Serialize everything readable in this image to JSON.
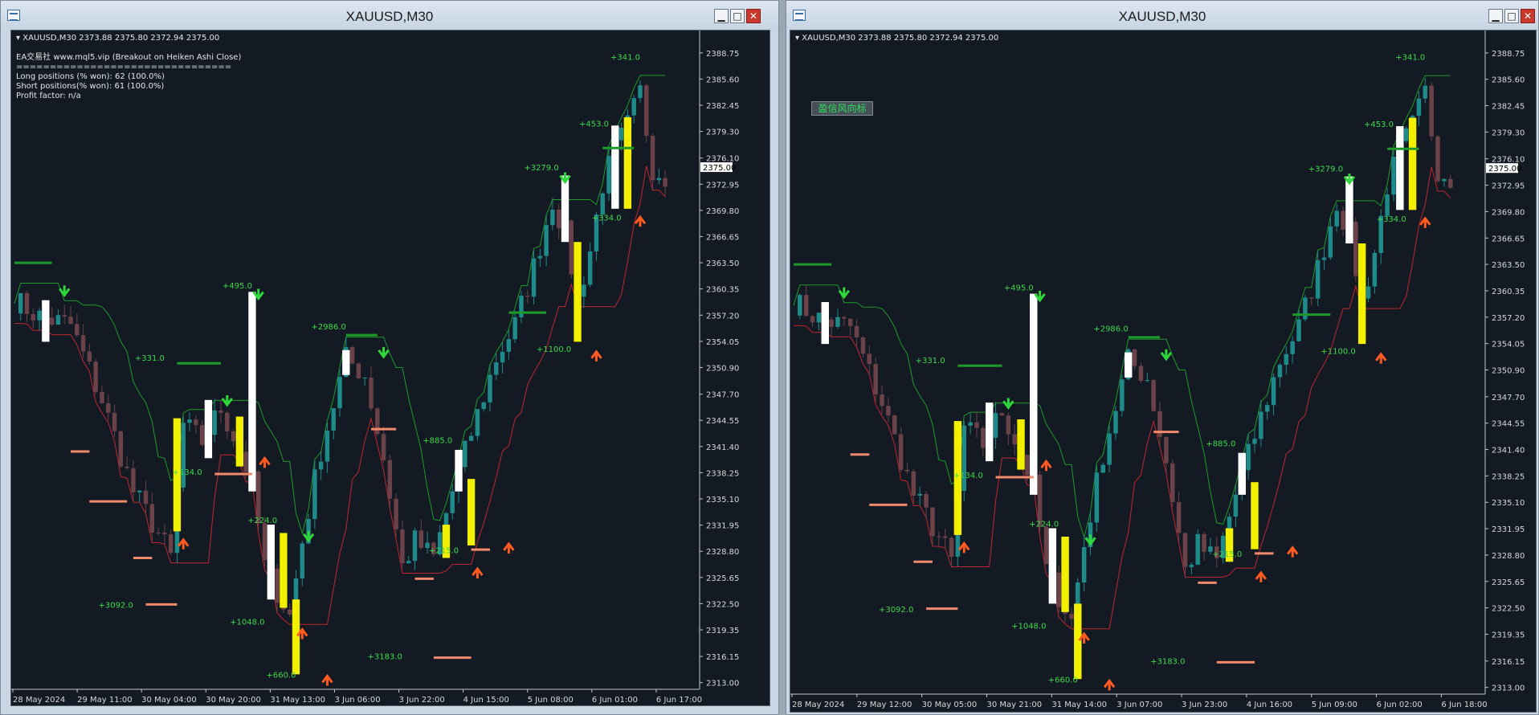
{
  "windows": [
    {
      "id": "left",
      "title": "XAUUSD,M30",
      "ohlc": "XAUUSD,M30  2373.88 2375.80 2372.94 2375.00",
      "info_lines": [
        "EA交易社 www.mql5.vip (Breakout on Heiken Ashi Close)",
        "================================",
        "Long positions (% won): 62 (100.0%)",
        "Short positions(% won): 61 (100.0%)",
        "Profit factor: n/a"
      ],
      "price_tag": "2375.00",
      "x_labels": [
        "28 May 2024",
        "29 May 11:00",
        "30 May 04:00",
        "30 May 20:00",
        "31 May 13:00",
        "3 Jun 06:00",
        "3 Jun 22:00",
        "4 Jun 15:00",
        "5 Jun 08:00",
        "6 Jun 01:00",
        "6 Jun 17:00"
      ]
    },
    {
      "id": "right",
      "title": "XAUUSD,M30",
      "ohlc": "XAUUSD,M30  2373.88 2375.80 2372.94 2375.00",
      "label_button": "盈信风向标",
      "price_tag": "2375.00",
      "x_labels": [
        "28 May 2024",
        "29 May 12:00",
        "30 May 05:00",
        "30 May 21:00",
        "31 May 14:00",
        "3 Jun 07:00",
        "3 Jun 23:00",
        "4 Jun 16:00",
        "5 Jun 09:00",
        "6 Jun 02:00",
        "6 Jun 18:00"
      ]
    }
  ],
  "window_controls": {
    "minimize": "▁",
    "maximize": "□",
    "close": "✕"
  },
  "y_labels": [
    "2388.75",
    "2385.60",
    "2382.45",
    "2379.30",
    "2376.10",
    "2372.95",
    "2369.80",
    "2366.65",
    "2363.50",
    "2360.35",
    "2357.20",
    "2354.05",
    "2350.90",
    "2347.70",
    "2344.55",
    "2341.40",
    "2338.25",
    "2335.10",
    "2331.95",
    "2328.80",
    "2325.65",
    "2322.50",
    "2319.35",
    "2316.15",
    "2313.00"
  ],
  "trade_labels": [
    {
      "text": "+341.0",
      "bar": 100,
      "price": 2387.9
    },
    {
      "text": "+453.0",
      "bar": 95,
      "price": 2379.9
    },
    {
      "text": "+3279.0",
      "bar": 87,
      "price": 2374.6
    },
    {
      "text": "+334.0",
      "bar": 97,
      "price": 2368.6
    },
    {
      "text": "+495.0",
      "bar": 38,
      "price": 2360.4
    },
    {
      "text": "+2986.0",
      "bar": 53,
      "price": 2355.5
    },
    {
      "text": "+1100.0",
      "bar": 89,
      "price": 2352.8
    },
    {
      "text": "+331.0",
      "bar": 24,
      "price": 2351.7
    },
    {
      "text": "+885.0",
      "bar": 70,
      "price": 2341.8
    },
    {
      "text": "+134.0",
      "bar": 30,
      "price": 2338.0
    },
    {
      "text": "+224.0",
      "bar": 42,
      "price": 2332.2
    },
    {
      "text": "+215.0",
      "bar": 71,
      "price": 2328.6
    },
    {
      "text": "+3092.0",
      "bar": 19,
      "price": 2322.0
    },
    {
      "text": "+1048.0",
      "bar": 40,
      "price": 2320.0
    },
    {
      "text": "+3183.0",
      "bar": 62,
      "price": 2315.8
    },
    {
      "text": "+660.0",
      "bar": 45,
      "price": 2313.6
    }
  ],
  "colors": {
    "background": "#131a24",
    "bull_candle": "#1f8a8a",
    "bear_candle": "#6b4248",
    "upper_band": "#1e9a2a",
    "lower_band": "#c2262e",
    "label_green": "#3fd94a",
    "sell_arrow": "#2fd83a",
    "buy_arrow": "#ff5a1f",
    "highlight_yellow": "#f2f000",
    "highlight_white": "#ffffff",
    "salmon_level": "#f08a6a"
  }
}
